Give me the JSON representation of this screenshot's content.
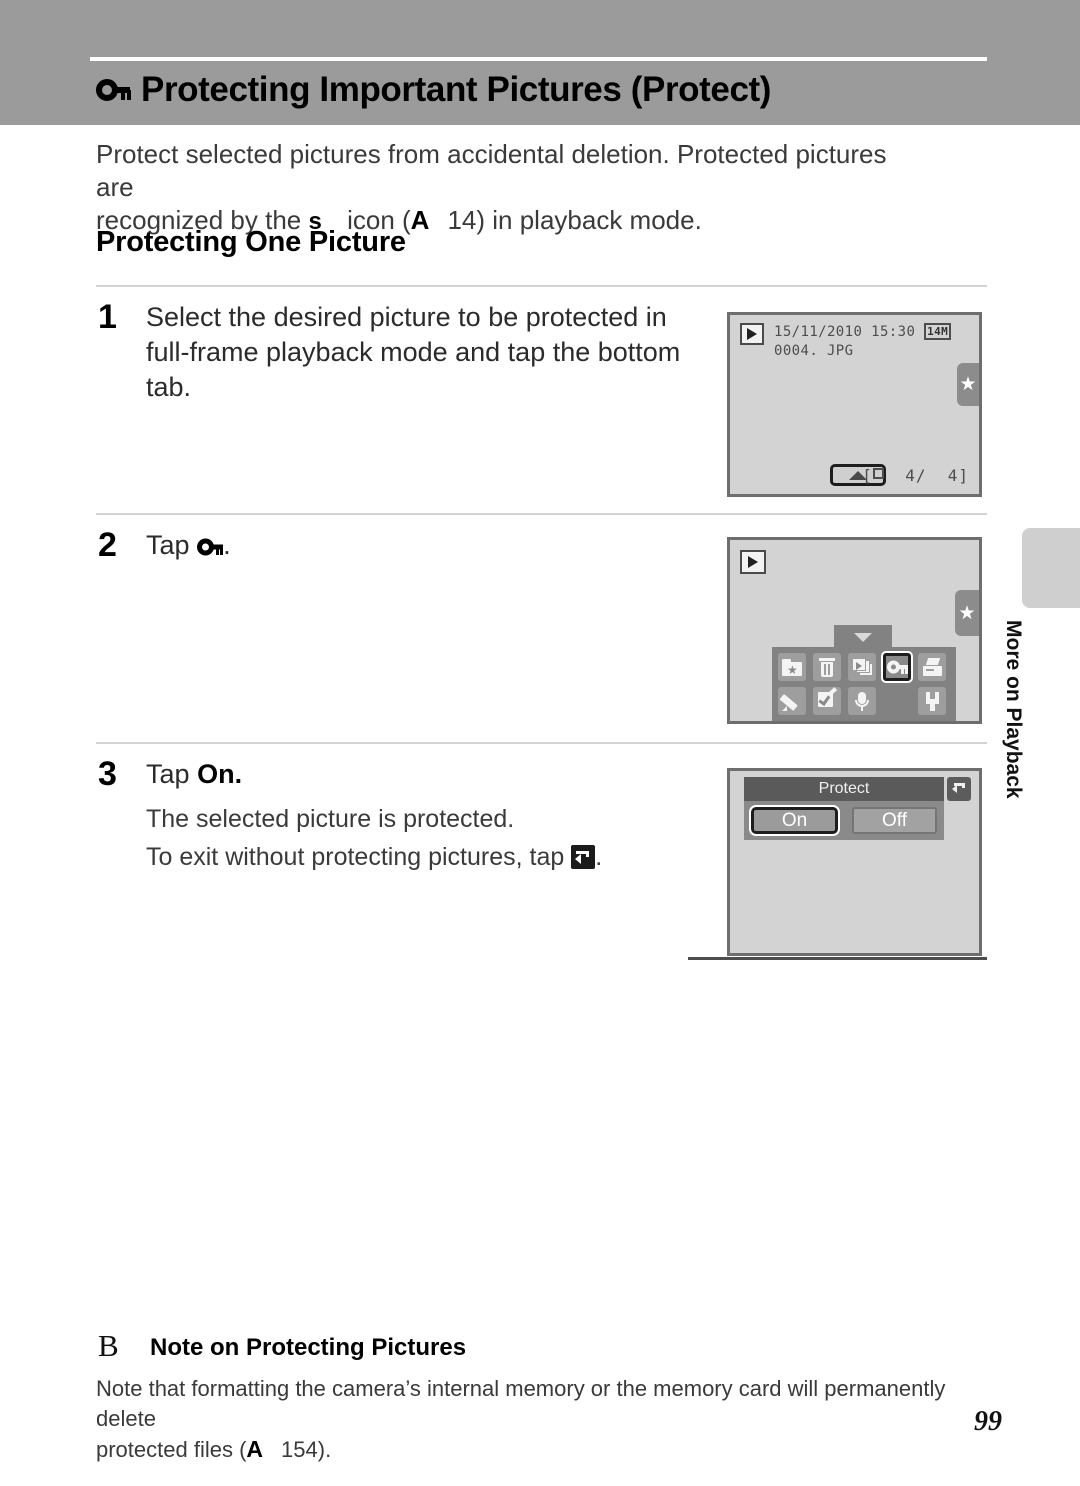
{
  "page": {
    "number": "99",
    "side_tab_label": "More on Playback"
  },
  "header": {
    "icon": "key-icon",
    "title": "Protecting Important Pictures (Protect)"
  },
  "intro": {
    "line1": "Protect selected pictures from accidental deletion. Protected pictures are",
    "line2_pre": "recognized by the",
    "lock_glyph": "s",
    "line2_mid": "icon (",
    "a_glyph": "A",
    "page_ref": "14",
    "line2_post": ") in playback mode."
  },
  "section": {
    "heading": "Protecting One Picture"
  },
  "steps": [
    {
      "number": "1",
      "text": "Select the desired picture to be protected in full-frame playback mode and tap the bottom tab."
    },
    {
      "number": "2",
      "text_pre": "Tap",
      "icon": "key-icon",
      "text_post": "."
    },
    {
      "number": "3",
      "text_pre": "Tap",
      "text_bold": "On",
      "text_post": ".",
      "sub1": "The selected picture is protected.",
      "sub2_pre": "To exit without protecting pictures, tap",
      "sub2_icon": "back-arrow-icon",
      "sub2_post": "."
    }
  ],
  "screen1": {
    "playback_icon": "playback-mode-icon",
    "date": "15/11/2010",
    "time": "15:30",
    "image_size": "14M",
    "filename": "0004. JPG",
    "star_icon": "star-icon",
    "bottom_tab_icon": "up-arrow-icon",
    "frame_counter_prefix": "[",
    "frame_current": "4/",
    "frame_total": "4]"
  },
  "screen2": {
    "playback_icon": "playback-mode-icon",
    "star_icon": "star-icon",
    "handle_icon": "down-arrow-icon",
    "menu_row1": [
      {
        "icon": "favorite-pictures-icon",
        "selected": false
      },
      {
        "icon": "delete-icon",
        "selected": false
      },
      {
        "icon": "slide-show-icon",
        "selected": false
      },
      {
        "icon": "protect-key-icon",
        "selected": true
      },
      {
        "icon": "print-order-icon",
        "selected": false
      }
    ],
    "menu_row2": [
      {
        "icon": "quick-retouch-icon",
        "selected": false
      },
      {
        "icon": "edit-icon",
        "selected": false
      },
      {
        "icon": "voice-memo-icon",
        "selected": false
      },
      {
        "icon": "blank",
        "selected": false
      },
      {
        "icon": "setup-wrench-icon",
        "selected": false
      }
    ]
  },
  "screen3": {
    "dialog_title": "Protect",
    "option_on": "On",
    "option_off": "Off",
    "back_icon": "back-arrow-icon",
    "selected_option": "On"
  },
  "note": {
    "icon": "B",
    "heading": "Note on Protecting Pictures",
    "line1": "Note that formatting the camera’s internal memory or the memory card will permanently delete",
    "line2_pre": "protected files (",
    "a_glyph": "A",
    "page_ref": "154",
    "line2_post": ")."
  },
  "colors": {
    "header_band": "#9b9b9b",
    "screen_bg": "#d3d3d3",
    "screen_border": "#6e6e6e",
    "menu_panel": "#828282",
    "dialog_title": "#5a5a5a",
    "side_tab": "#cfcfcf"
  }
}
